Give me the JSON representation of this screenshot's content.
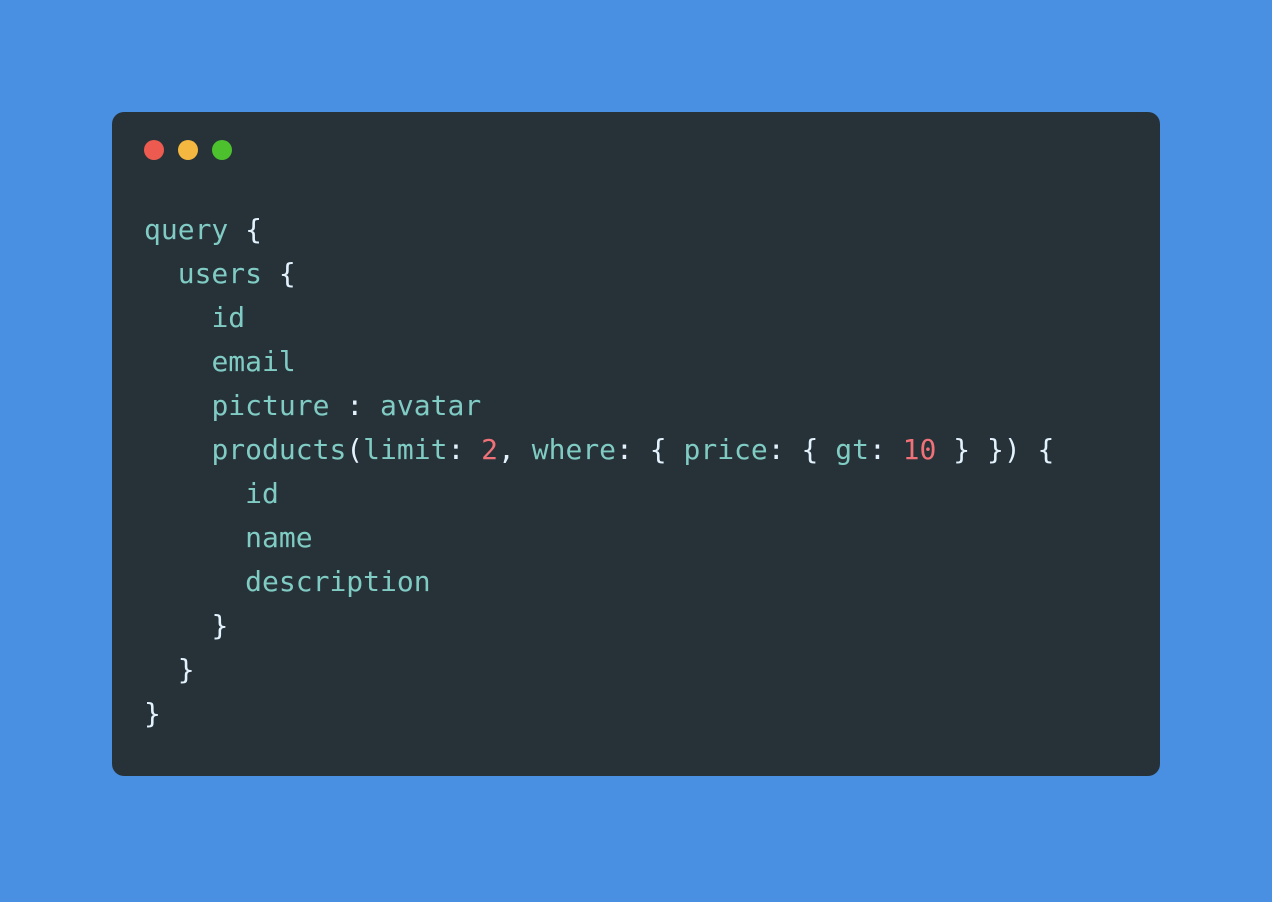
{
  "code": {
    "keyword_query": "query",
    "brace_open": "{",
    "brace_close": "}",
    "paren_open": "(",
    "paren_close": ")",
    "colon": ":",
    "comma": ",",
    "users": "users",
    "id": "id",
    "email": "email",
    "picture": "picture",
    "avatar": "avatar",
    "products": "products",
    "limit": "limit",
    "limit_value": "2",
    "where": "where",
    "price": "price",
    "gt": "gt",
    "gt_value": "10",
    "name": "name",
    "description": "description"
  }
}
